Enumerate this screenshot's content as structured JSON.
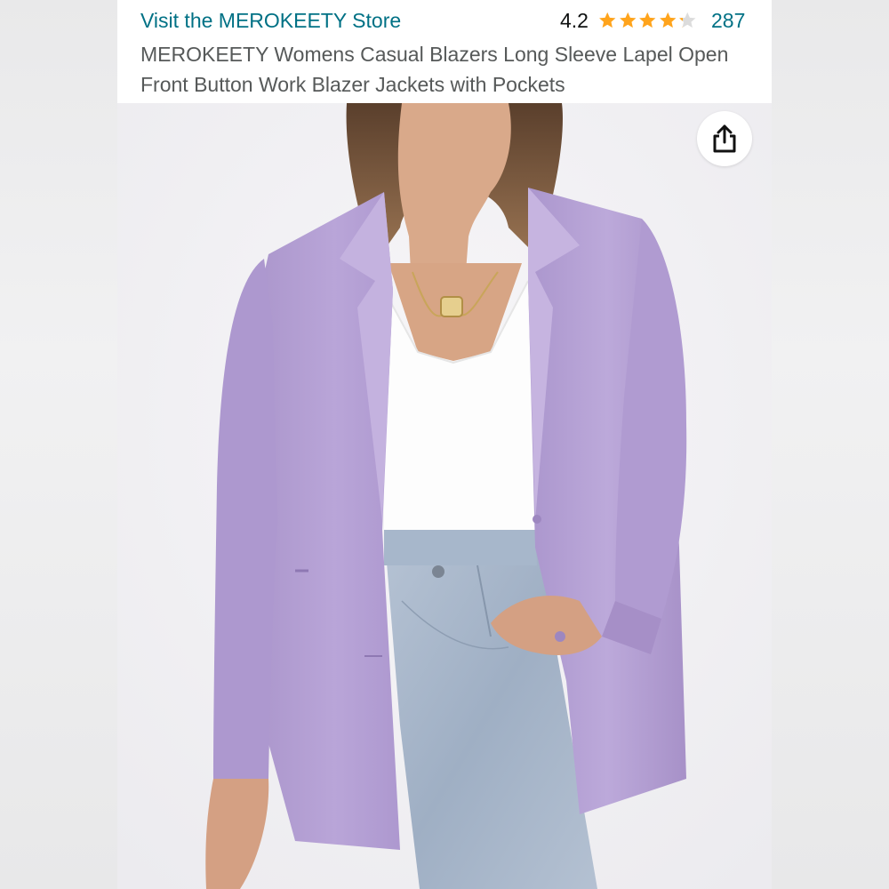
{
  "store": {
    "link_label": "Visit the MEROKEETY Store"
  },
  "rating": {
    "value": "4.2",
    "stars": 4.2,
    "max_stars": 5,
    "review_count": "287"
  },
  "product": {
    "title": "MEROKEETY Womens Casual Blazers Long Sleeve Lapel Open Front Button Work Blazer Jackets with Pockets",
    "image_icon": "product-photo-lavender-blazer"
  },
  "colors": {
    "link": "#007185",
    "star_fill": "#ffa41c",
    "star_empty": "#dcdcdc",
    "blazer": "#b8a3d6",
    "jeans": "#a9b8cc",
    "top": "#ffffff"
  },
  "share": {
    "icon": "share-icon"
  }
}
